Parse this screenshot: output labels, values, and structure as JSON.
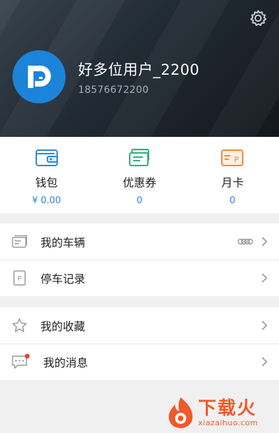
{
  "profile": {
    "username": "好多位用户_2200",
    "phone": "18576672200"
  },
  "stats": [
    {
      "label": "钱包",
      "value": "¥ 0.00",
      "icon": "wallet-icon"
    },
    {
      "label": "优惠券",
      "value": "0",
      "icon": "coupon-icon"
    },
    {
      "label": "月卡",
      "value": "0",
      "icon": "monthly-card-icon"
    }
  ],
  "menu_group_1": [
    {
      "label": "我的车辆",
      "icon": "vehicle-card-icon"
    },
    {
      "label": "停车记录",
      "icon": "parking-record-icon"
    }
  ],
  "menu_group_2": [
    {
      "label": "我的收藏",
      "icon": "star-icon"
    },
    {
      "label": "我的消息",
      "icon": "message-icon"
    }
  ],
  "watermark": {
    "title": "下载火",
    "subtitle": "xiazaihuo.com"
  },
  "colors": {
    "accent_blue": "#2a86d6",
    "avatar_blue": "#1c84d8",
    "wallet_blue": "#2a8ad8",
    "coupon_green": "#2fb07a",
    "card_orange": "#f08a3c",
    "badge_red": "#e8432e"
  }
}
